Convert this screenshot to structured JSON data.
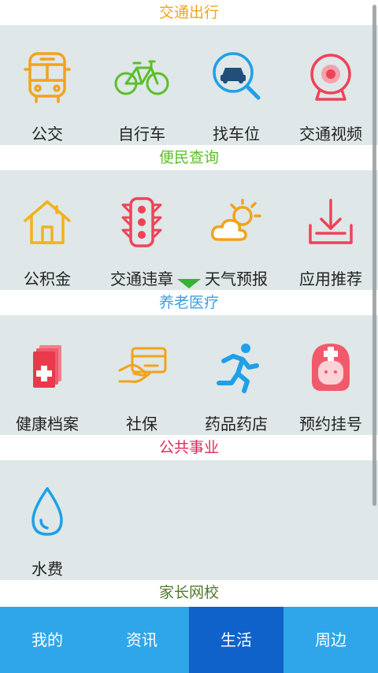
{
  "sections": [
    {
      "title": "交通出行",
      "color": "#f2a31b",
      "items": [
        {
          "label": "公交",
          "icon": "bus-icon"
        },
        {
          "label": "自行车",
          "icon": "bicycle-icon"
        },
        {
          "label": "找车位",
          "icon": "car-search-icon"
        },
        {
          "label": "交通视频",
          "icon": "webcam-icon"
        }
      ]
    },
    {
      "title": "便民查询",
      "color": "#5cbf2a",
      "items": [
        {
          "label": "公积金",
          "icon": "house-icon"
        },
        {
          "label": "交通违章",
          "icon": "traffic-light-icon"
        },
        {
          "label": "天气预报",
          "icon": "weather-icon"
        },
        {
          "label": "应用推荐",
          "icon": "download-icon"
        }
      ]
    },
    {
      "title": "养老医疗",
      "color": "#3f9fe0",
      "items": [
        {
          "label": "健康档案",
          "icon": "health-record-icon"
        },
        {
          "label": "社保",
          "icon": "card-hand-icon"
        },
        {
          "label": "药品药店",
          "icon": "runner-icon"
        },
        {
          "label": "预约挂号",
          "icon": "nurse-icon"
        }
      ]
    },
    {
      "title": "公共事业",
      "color": "#e0295c",
      "items": [
        {
          "label": "水费",
          "icon": "water-drop-icon"
        }
      ]
    },
    {
      "title": "家长网校",
      "color": "#4e7a2a"
    }
  ],
  "tabs": [
    {
      "label": "我的"
    },
    {
      "label": "资讯"
    },
    {
      "label": "生活",
      "active": true
    },
    {
      "label": "周边"
    }
  ],
  "colors": {
    "tab_bg": "#2fa6ea",
    "tab_active": "#0f62c9",
    "grid_bg": "#dfe7e8"
  }
}
